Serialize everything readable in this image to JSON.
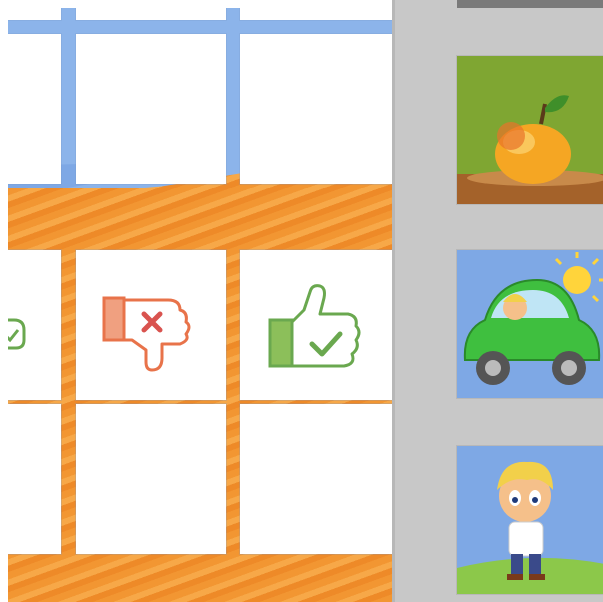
{
  "board": {
    "cards": [
      {
        "row": "top",
        "col": "left",
        "content": "blank"
      },
      {
        "row": "top",
        "col": "middle",
        "content": "blank"
      },
      {
        "row": "top",
        "col": "right",
        "content": "blank"
      },
      {
        "row": "middle",
        "col": "left",
        "content": "thumbs-up"
      },
      {
        "row": "middle",
        "col": "middle",
        "content": "thumbs-down"
      },
      {
        "row": "middle",
        "col": "right",
        "content": "thumbs-up"
      },
      {
        "row": "bottom",
        "col": "left",
        "content": "blank"
      },
      {
        "row": "bottom",
        "col": "middle",
        "content": "blank"
      },
      {
        "row": "bottom",
        "col": "right",
        "content": "blank"
      }
    ],
    "icons": {
      "dislike": "thumbs-down-icon",
      "like": "thumbs-up-icon"
    },
    "colors": {
      "like_green": "#6aa84f",
      "dislike_orange": "#e8734a",
      "sand": "#f29632",
      "sky": "#8cb4ea"
    }
  },
  "sidebar": {
    "thumbnails": [
      {
        "subject": "orange-fruit-on-table"
      },
      {
        "subject": "boy-in-green-car"
      },
      {
        "subject": "boy-standing-on-hill"
      }
    ]
  }
}
